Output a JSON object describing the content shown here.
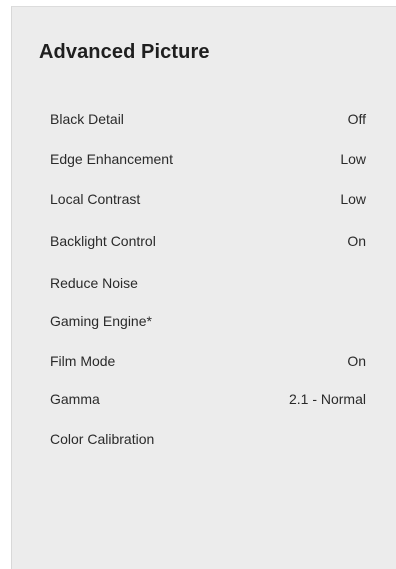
{
  "panel": {
    "title": "Advanced Picture"
  },
  "menu": {
    "items": [
      {
        "label": "Black Detail",
        "value": "Off"
      },
      {
        "label": "Edge Enhancement",
        "value": "Low"
      },
      {
        "label": "Local Contrast",
        "value": "Low"
      },
      {
        "label": "Backlight Control",
        "value": "On"
      },
      {
        "label": "Reduce Noise",
        "value": ""
      },
      {
        "label": "Gaming Engine*",
        "value": ""
      },
      {
        "label": "Film Mode",
        "value": "On"
      },
      {
        "label": "Gamma",
        "value": "2.1 - Normal"
      },
      {
        "label": "Color Calibration",
        "value": ""
      }
    ]
  },
  "colors": {
    "panel_background": "#ececec",
    "text": "#2a2a2a",
    "title_text": "#1f1f1f"
  }
}
